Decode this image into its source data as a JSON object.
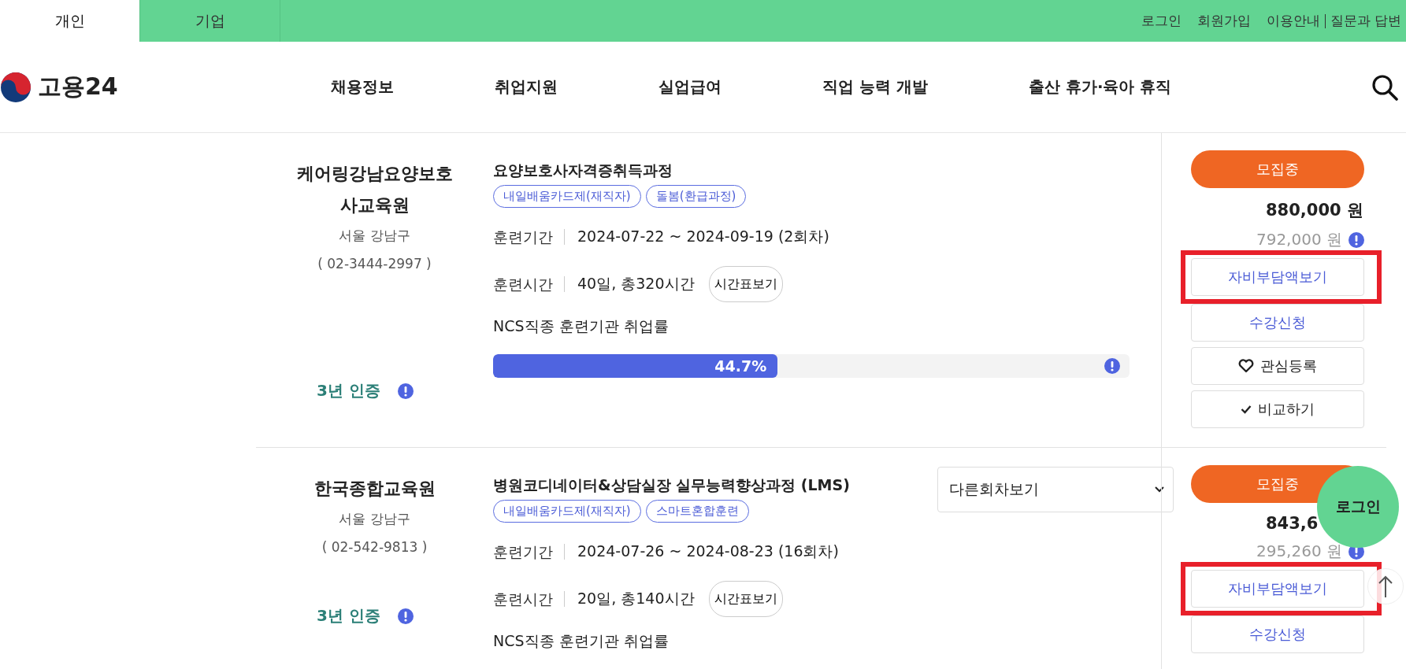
{
  "top_bar": {
    "tabs": [
      {
        "label": "개인",
        "selected": true
      },
      {
        "label": "기업",
        "selected": false
      }
    ],
    "links": [
      "로그인",
      "회원가입",
      "이용안내",
      "질문과 답변"
    ]
  },
  "header": {
    "logo": "고용24",
    "nav": [
      "채용정보",
      "취업지원",
      "실업급여",
      "직업 능력 개발",
      "출산 휴가·육아 휴직"
    ]
  },
  "courses": [
    {
      "institution": "케어링강남요양보호사교육원",
      "region": "서울 강남구",
      "phone": "( 02-3444-2997 )",
      "certification": "3년 인증",
      "title": "요양보호사자격증취득과정",
      "tags": [
        "내일배움카드제(재직자)",
        "돌봄(환급과정)"
      ],
      "period_label": "훈련기간",
      "period": "2024-07-22 ~ 2024-09-19 (2회차)",
      "hours_label": "훈련시간",
      "hours": "40일, 총320시간",
      "timetable_button": "시간표보기",
      "rate_label": "NCS직종 훈련기관 취업률",
      "rate": {
        "level": 0.447,
        "reading": "44.7%"
      },
      "status": "모집중",
      "price": "880,000 원",
      "self_pay": "792,000 원",
      "actions": [
        {
          "kind": "link",
          "label": "자비부담액보기",
          "highlighted": true
        },
        {
          "kind": "link",
          "label": "수강신청",
          "highlighted": false
        },
        {
          "kind": "heart",
          "label": "관심등록",
          "highlighted": false
        },
        {
          "kind": "check",
          "label": "비교하기",
          "highlighted": false
        }
      ]
    },
    {
      "institution": "한국종합교육원",
      "region": "서울 강남구",
      "phone": "( 02-542-9813 )",
      "certification": "3년 인증",
      "title": "병원코디네이터&상담실장 실무능력향상과정 (LMS)",
      "other_rounds": "다른회차보기",
      "tags": [
        "내일배움카드제(재직자)",
        "스마트혼합훈련"
      ],
      "period_label": "훈련기간",
      "period": "2024-07-26 ~ 2024-08-23 (16회차)",
      "hours_label": "훈련시간",
      "hours": "20일, 총140시간",
      "timetable_button": "시간표보기",
      "rate_label": "NCS직종 훈련기관 취업률",
      "status": "모집중",
      "price": "843,6",
      "self_pay": "295,260 원",
      "actions": [
        {
          "kind": "link",
          "label": "자비부담액보기",
          "highlighted": true
        },
        {
          "kind": "link",
          "label": "수강신청",
          "highlighted": false
        }
      ]
    }
  ],
  "floating": {
    "login": "로그인"
  }
}
